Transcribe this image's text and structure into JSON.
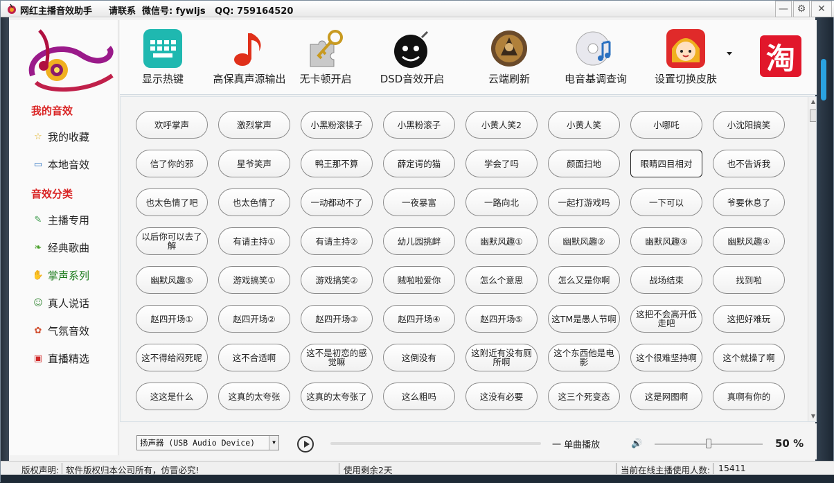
{
  "window": {
    "title": "网红主播音效助手",
    "contact": "请联系  微信号: fywljs   QQ: 759164520"
  },
  "sidebar": {
    "my_sounds_title": "我的音效",
    "my_items": [
      {
        "label": "我的收藏",
        "icon": "star-icon"
      },
      {
        "label": "本地音效",
        "icon": "monitor-icon"
      }
    ],
    "category_title": "音效分类",
    "category_items": [
      {
        "label": "主播专用",
        "icon": "microphone-icon"
      },
      {
        "label": "经典歌曲",
        "icon": "leaf-icon"
      },
      {
        "label": "掌声系列",
        "icon": "clap-icon",
        "active": true
      },
      {
        "label": "真人说话",
        "icon": "person-icon"
      },
      {
        "label": "气氛音效",
        "icon": "flower-icon"
      },
      {
        "label": "直播精选",
        "icon": "gift-icon"
      }
    ]
  },
  "toolbar": {
    "items": [
      {
        "label": "显示热键",
        "icon": "keyboard-icon"
      },
      {
        "label": "高保真声源输出",
        "icon": "music-note-icon"
      },
      {
        "label": "无卡顿开启",
        "icon": "puzzle-key-icon"
      },
      {
        "label": "DSD音效开启",
        "icon": "bomb-face-icon"
      },
      {
        "label": "云端刷新",
        "icon": "warrior-icon"
      },
      {
        "label": "电音基调查询",
        "icon": "cd-music-icon"
      },
      {
        "label": "设置切换皮肤",
        "icon": "cartoon-girl-icon"
      }
    ],
    "taobao_label": "淘"
  },
  "sounds": [
    [
      "欢呼掌声",
      "激烈掌声",
      "小黑粉滚犊子",
      "小黑粉滚子",
      "小黄人笑2",
      "小黄人笑",
      "小哪吒",
      "小沈阳搞笑"
    ],
    [
      "信了你的邪",
      "星爷笑声",
      "鸭王那不算",
      "薛定谔的猫",
      "学会了吗",
      "颜面扫地",
      "眼睛四目相对",
      "也不告诉我"
    ],
    [
      "也太色情了吧",
      "也太色情了",
      "一动都动不了",
      "一夜暴富",
      "一路向北",
      "一起打游戏吗",
      "一下可以",
      "爷要休息了"
    ],
    [
      "以后你可以去了解",
      "有请主持①",
      "有请主持②",
      "幼儿园挑衅",
      "幽默风趣①",
      "幽默风趣②",
      "幽默风趣③",
      "幽默风趣④"
    ],
    [
      "幽默风趣⑤",
      "游戏搞笑①",
      "游戏搞笑②",
      "贼啦啦爱你",
      "怎么个意思",
      "怎么又是你啊",
      "战场结束",
      "找到啦"
    ],
    [
      "赵四开场①",
      "赵四开场②",
      "赵四开场③",
      "赵四开场④",
      "赵四开场⑤",
      "这TM是愚人节啊",
      "这把不会高开低走吧",
      "这把好难玩"
    ],
    [
      "这不得给闷死呢",
      "这不合适啊",
      "这不是初恋的感觉嘛",
      "这倒没有",
      "这附近有没有厕所啊",
      "这个东西他是电影",
      "这个很难坚持啊",
      "这个就操了啊"
    ],
    [
      "这这是什么",
      "这真的太夸张",
      "这真的太夸张了",
      "这么粗吗",
      "这没有必要",
      "这三个死变态",
      "这是网图啊",
      "真啊有你的"
    ]
  ],
  "selected_sound": "眼睛四目相对",
  "player": {
    "device": "扬声器 (USB Audio Device)",
    "mode": "一 单曲播放",
    "volume_percent": "50 %",
    "volume_level": 0.5,
    "progress": 0
  },
  "statusbar": {
    "copyright_label": "版权声明:",
    "copyright_text": "软件版权归本公司所有，仿冒必究!",
    "remaining": "使用剩余2天",
    "online_label": "当前在线主播使用人数:",
    "online_count": "15411"
  },
  "colors": {
    "accent_red": "#d92323",
    "active_green": "#1a7a1a",
    "taobao_red": "#e1172b"
  }
}
